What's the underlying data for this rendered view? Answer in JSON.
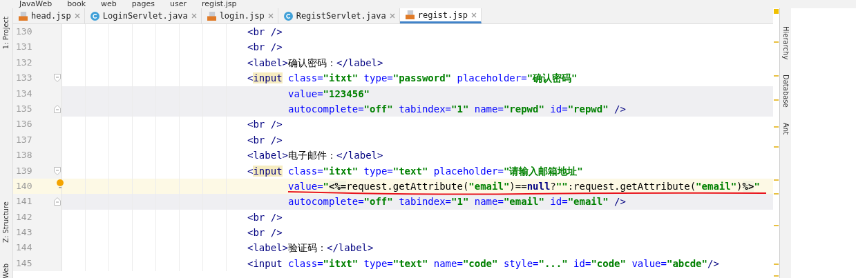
{
  "breadcrumb": [
    "JavaWeb",
    "book",
    "web",
    "pages",
    "user",
    "regist.jsp"
  ],
  "tabs": [
    {
      "label": "head.jsp",
      "kind": "jsp",
      "selected": false
    },
    {
      "label": "LoginServlet.java",
      "kind": "class",
      "selected": false
    },
    {
      "label": "login.jsp",
      "kind": "jsp",
      "selected": false
    },
    {
      "label": "RegistServlet.java",
      "kind": "class",
      "selected": false
    },
    {
      "label": "regist.jsp",
      "kind": "jsp",
      "selected": true
    }
  ],
  "left_tools": [
    "1: Project",
    "Z: Structure",
    "Web"
  ],
  "right_tools": [
    "Hierarchy",
    "Database",
    "Ant"
  ],
  "lines": [
    {
      "number": "130",
      "cont": false,
      "current": false,
      "shaded": false,
      "tokens": [
        {
          "kind": "tag",
          "t": "<br />"
        }
      ]
    },
    {
      "number": "131",
      "cont": false,
      "current": false,
      "shaded": false,
      "tokens": [
        {
          "kind": "tag",
          "t": "<br />"
        }
      ]
    },
    {
      "number": "132",
      "cont": false,
      "current": false,
      "shaded": false,
      "tokens": [
        {
          "kind": "tag",
          "t": "<label>"
        },
        {
          "kind": "text",
          "t": "确认密码："
        },
        {
          "kind": "tag",
          "t": "</label>"
        }
      ]
    },
    {
      "number": "133",
      "cont": false,
      "current": false,
      "shaded": false,
      "fold": {
        "kind": "start"
      },
      "tokens": [
        {
          "kind": "tag",
          "t": "<"
        },
        {
          "kind": "match",
          "t": "input"
        },
        {
          "kind": "attr",
          "t": " class="
        },
        {
          "kind": "str",
          "t": "\"itxt\""
        },
        {
          "kind": "attr",
          "t": " type="
        },
        {
          "kind": "str",
          "t": "\"password\""
        },
        {
          "kind": "attr",
          "t": " placeholder="
        },
        {
          "kind": "str",
          "t": "\"确认密码\""
        }
      ]
    },
    {
      "number": "134",
      "cont": true,
      "current": false,
      "shaded": true,
      "tokens": [
        {
          "kind": "attr",
          "t": "value="
        },
        {
          "kind": "str",
          "t": "\"123456\""
        }
      ]
    },
    {
      "number": "135",
      "cont": true,
      "current": false,
      "shaded": true,
      "fold": {
        "kind": "end"
      },
      "tokens": [
        {
          "kind": "attr",
          "t": "autocomplete="
        },
        {
          "kind": "str",
          "t": "\"off\""
        },
        {
          "kind": "attr",
          "t": " tabindex="
        },
        {
          "kind": "str",
          "t": "\"1\""
        },
        {
          "kind": "attr",
          "t": " name="
        },
        {
          "kind": "str",
          "t": "\"repwd\""
        },
        {
          "kind": "attr",
          "t": " id="
        },
        {
          "kind": "str",
          "t": "\"repwd\""
        },
        {
          "kind": "tag",
          "t": " />"
        }
      ]
    },
    {
      "number": "136",
      "cont": false,
      "current": false,
      "shaded": false,
      "tokens": [
        {
          "kind": "tag",
          "t": "<br />"
        }
      ]
    },
    {
      "number": "137",
      "cont": false,
      "current": false,
      "shaded": false,
      "tokens": [
        {
          "kind": "tag",
          "t": "<br />"
        }
      ]
    },
    {
      "number": "138",
      "cont": false,
      "current": false,
      "shaded": false,
      "tokens": [
        {
          "kind": "tag",
          "t": "<label>"
        },
        {
          "kind": "text",
          "t": "电子邮件："
        },
        {
          "kind": "tag",
          "t": "</label>"
        }
      ]
    },
    {
      "number": "139",
      "cont": false,
      "current": false,
      "shaded": false,
      "fold": {
        "kind": "start"
      },
      "tokens": [
        {
          "kind": "tag",
          "t": "<"
        },
        {
          "kind": "match",
          "t": "input"
        },
        {
          "kind": "attr",
          "t": " class="
        },
        {
          "kind": "str",
          "t": "\"itxt\""
        },
        {
          "kind": "attr",
          "t": " type="
        },
        {
          "kind": "str",
          "t": "\"text\""
        },
        {
          "kind": "attr",
          "t": " placeholder="
        },
        {
          "kind": "str",
          "t": "\"请输入邮箱地址\""
        }
      ]
    },
    {
      "number": "140",
      "cont": true,
      "current": true,
      "shaded": false,
      "bulb": true,
      "underlined": true,
      "tokens": [
        {
          "kind": "attr",
          "t": "value="
        },
        {
          "kind": "str",
          "t": "\""
        },
        {
          "kind": "jsp",
          "t": "<%="
        },
        {
          "kind": "text",
          "t": "request.getAttribute("
        },
        {
          "kind": "str",
          "t": "\"email\""
        },
        {
          "kind": "text",
          "t": ")=="
        },
        {
          "kind": "kw",
          "t": "null"
        },
        {
          "kind": "text",
          "t": "?"
        },
        {
          "kind": "str",
          "t": "\"\""
        },
        {
          "kind": "text",
          "t": ":request.getAttribute("
        },
        {
          "kind": "str",
          "t": "\"email\""
        },
        {
          "kind": "text",
          "t": ")"
        },
        {
          "kind": "jsp",
          "t": "%>"
        },
        {
          "kind": "str",
          "t": "\""
        }
      ]
    },
    {
      "number": "141",
      "cont": true,
      "current": false,
      "shaded": true,
      "fold": {
        "kind": "end"
      },
      "tokens": [
        {
          "kind": "attr",
          "t": "autocomplete="
        },
        {
          "kind": "str",
          "t": "\"off\""
        },
        {
          "kind": "attr",
          "t": " tabindex="
        },
        {
          "kind": "str",
          "t": "\"1\""
        },
        {
          "kind": "attr",
          "t": " name="
        },
        {
          "kind": "str",
          "t": "\"email\""
        },
        {
          "kind": "attr",
          "t": " id="
        },
        {
          "kind": "str",
          "t": "\"email\""
        },
        {
          "kind": "tag",
          "t": " />"
        }
      ]
    },
    {
      "number": "142",
      "cont": false,
      "current": false,
      "shaded": false,
      "tokens": [
        {
          "kind": "tag",
          "t": "<br />"
        }
      ]
    },
    {
      "number": "143",
      "cont": false,
      "current": false,
      "shaded": false,
      "tokens": [
        {
          "kind": "tag",
          "t": "<br />"
        }
      ]
    },
    {
      "number": "144",
      "cont": false,
      "current": false,
      "shaded": false,
      "tokens": [
        {
          "kind": "tag",
          "t": "<label>"
        },
        {
          "kind": "text",
          "t": "验证码："
        },
        {
          "kind": "tag",
          "t": "</label>"
        }
      ]
    },
    {
      "number": "145",
      "cont": false,
      "current": false,
      "shaded": false,
      "tokens": [
        {
          "kind": "tag",
          "t": "<input"
        },
        {
          "kind": "attr",
          "t": " class="
        },
        {
          "kind": "str",
          "t": "\"itxt\""
        },
        {
          "kind": "attr",
          "t": " type="
        },
        {
          "kind": "str",
          "t": "\"text\""
        },
        {
          "kind": "attr",
          "t": " name="
        },
        {
          "kind": "str",
          "t": "\"code\""
        },
        {
          "kind": "attr",
          "t": " style="
        },
        {
          "kind": "str",
          "t": "\"...\""
        },
        {
          "kind": "attr",
          "t": " id="
        },
        {
          "kind": "str",
          "t": "\"code\""
        },
        {
          "kind": "attr",
          "t": " value="
        },
        {
          "kind": "str",
          "t": "\"abcde\""
        },
        {
          "kind": "tag",
          "t": "/>"
        }
      ]
    }
  ]
}
